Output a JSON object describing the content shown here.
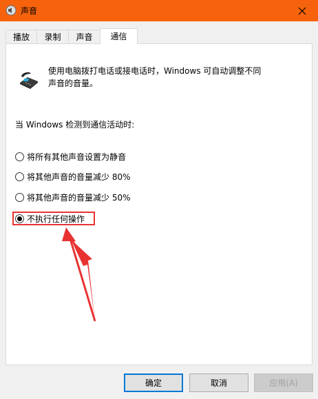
{
  "window": {
    "title": "声音"
  },
  "tabs": [
    {
      "label": "播放"
    },
    {
      "label": "录制"
    },
    {
      "label": "声音"
    },
    {
      "label": "通信",
      "active": true
    }
  ],
  "communications": {
    "description_line1": "使用电脑拨打电话或接电话时，Windows 可自动调整不同",
    "description_line2": "声音的音量。",
    "section_label": "当 Windows 检测到通信活动时:",
    "options": [
      {
        "label": "将所有其他声音设置为静音",
        "checked": false
      },
      {
        "label": "将其他声音的音量减少 80%",
        "checked": false
      },
      {
        "label": "将其他声音的音量减少 50%",
        "checked": false
      },
      {
        "label": "不执行任何操作",
        "checked": true
      }
    ]
  },
  "buttons": {
    "ok": "确定",
    "cancel": "取消",
    "apply": "应用(A)"
  },
  "annotation": {
    "color": "#e83232"
  }
}
